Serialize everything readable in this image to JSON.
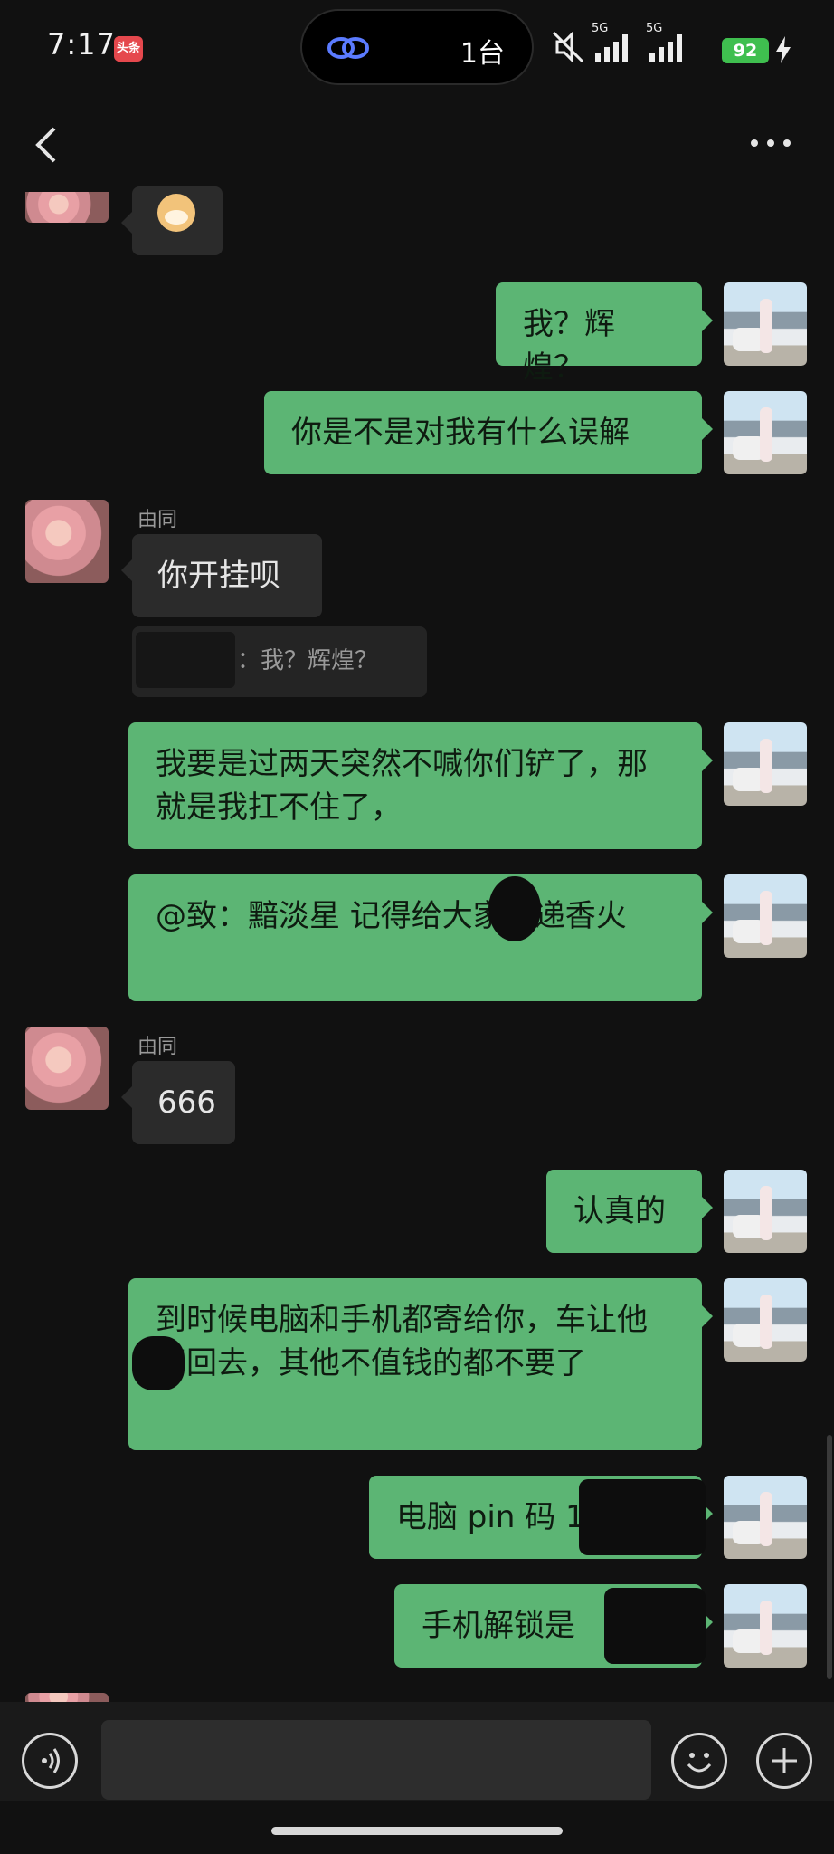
{
  "status": {
    "time": "7:17",
    "app_badge": "头条",
    "island_count": "1台",
    "network": "5G",
    "battery": "92"
  },
  "chat": {
    "messages": [
      {
        "from": "me",
        "text": "我？辉煌？"
      },
      {
        "from": "me",
        "text": "你是不是对我有什么误解"
      },
      {
        "from": "other",
        "name": "由同",
        "text": "你开挂呗"
      },
      {
        "from": "quote",
        "text": "：我？辉煌？"
      },
      {
        "from": "me",
        "text": "我要是过两天突然不喊你们铲了，那就是我扛不住了，"
      },
      {
        "from": "me",
        "text": "@致：黯淡星 记得给大家传递香火"
      },
      {
        "from": "other",
        "name": "由同",
        "text": "666"
      },
      {
        "from": "me",
        "text": "认真的"
      },
      {
        "from": "me",
        "text": "到时候电脑和手机都寄给你，车让他开回去，其他不值钱的都不要了"
      },
      {
        "from": "me",
        "text": "电脑 pin 码 1"
      },
      {
        "from": "me",
        "text": "手机解锁是"
      }
    ]
  },
  "inputbar": {
    "voice_icon": "voice-icon",
    "emoji_icon": "emoji-icon",
    "plus_icon": "plus-icon"
  },
  "colors": {
    "me_bubble": "#5cb574",
    "other_bubble": "#2b2b2b",
    "background": "#111111"
  }
}
